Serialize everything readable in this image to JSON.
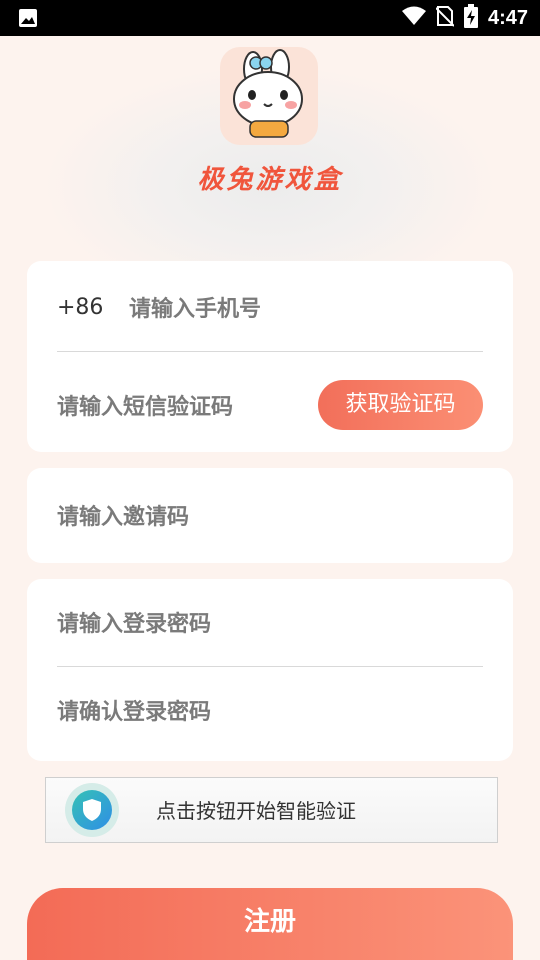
{
  "status_bar": {
    "time": "4:47",
    "icons": [
      "image-icon",
      "wifi-icon",
      "no-sim-icon",
      "battery-charging-icon"
    ]
  },
  "app": {
    "name": "极兔游戏盒",
    "logo": "bunny-mascot"
  },
  "form": {
    "phone_prefix": "+86",
    "phone_placeholder": "请输入手机号",
    "sms_code_placeholder": "请输入短信验证码",
    "get_code_button": "获取验证码",
    "invite_code_placeholder": "请输入邀请码",
    "password_placeholder": "请输入登录密码",
    "confirm_password_placeholder": "请确认登录密码"
  },
  "captcha": {
    "label": "点击按钮开始智能验证",
    "icon": "shield-icon"
  },
  "register_button": "注册",
  "colors": {
    "accent": "#f36b56",
    "background": "#fdf3ee"
  }
}
